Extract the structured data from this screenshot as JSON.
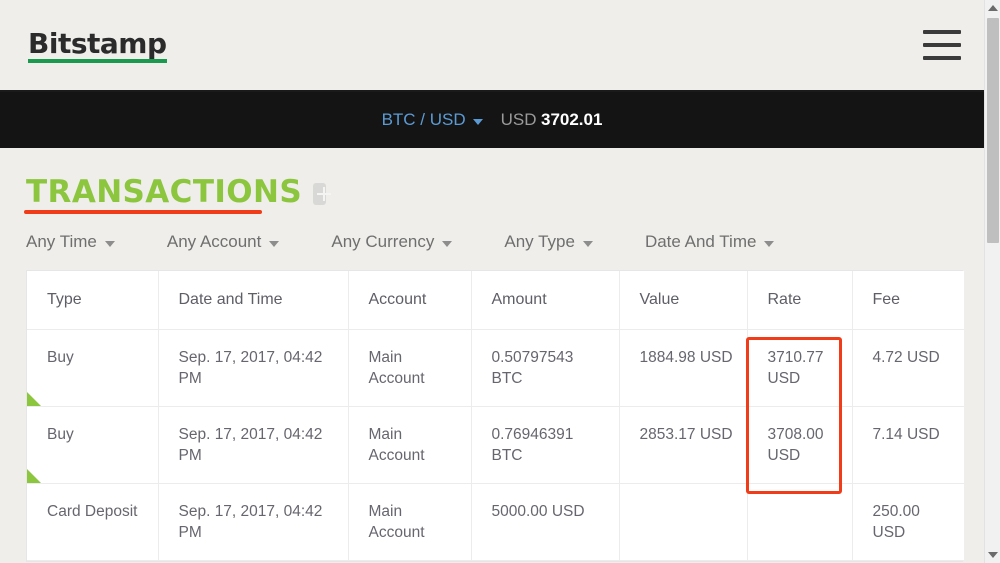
{
  "header": {
    "logo_text": "Bitstamp",
    "menu_icon": "hamburger-menu-icon"
  },
  "ticker": {
    "pair_label": "BTC / USD",
    "currency_label": "USD",
    "price": "3702.01"
  },
  "page": {
    "title": "TRANSACTIONS",
    "add_icon": "plus-icon"
  },
  "filters": [
    {
      "label": "Any Time"
    },
    {
      "label": "Any Account"
    },
    {
      "label": "Any Currency"
    },
    {
      "label": "Any Type"
    },
    {
      "label": "Date And Time"
    }
  ],
  "table": {
    "columns": [
      "Type",
      "Date and Time",
      "Account",
      "Amount",
      "Value",
      "Rate",
      "Fee"
    ],
    "rows": [
      {
        "type": "Buy",
        "datetime": "Sep. 17, 2017, 04:42 PM",
        "account": "Main Account",
        "amount": "0.50797543 BTC",
        "value": "1884.98 USD",
        "rate": "3710.77 USD",
        "fee": "4.72 USD",
        "marker": "green-corner"
      },
      {
        "type": "Buy",
        "datetime": "Sep. 17, 2017, 04:42 PM",
        "account": "Main Account",
        "amount": "0.76946391 BTC",
        "value": "2853.17 USD",
        "rate": "3708.00 USD",
        "fee": "7.14 USD",
        "marker": "green-corner"
      },
      {
        "type": "Card Deposit",
        "datetime": "Sep. 17, 2017, 04:42 PM",
        "account": "Main Account",
        "amount": "5000.00 USD",
        "value": "",
        "rate": "",
        "fee": "250.00 USD",
        "marker": ""
      }
    ]
  },
  "annotations": {
    "title_underline_color": "#f03c18",
    "rate_box_color": "#f03c18"
  },
  "colors": {
    "brand_green": "#1a9a4f",
    "title_green": "#8cc63e",
    "ticker_bg": "#141414",
    "page_bg": "#efeeea",
    "link_blue": "#5b9bd5"
  }
}
